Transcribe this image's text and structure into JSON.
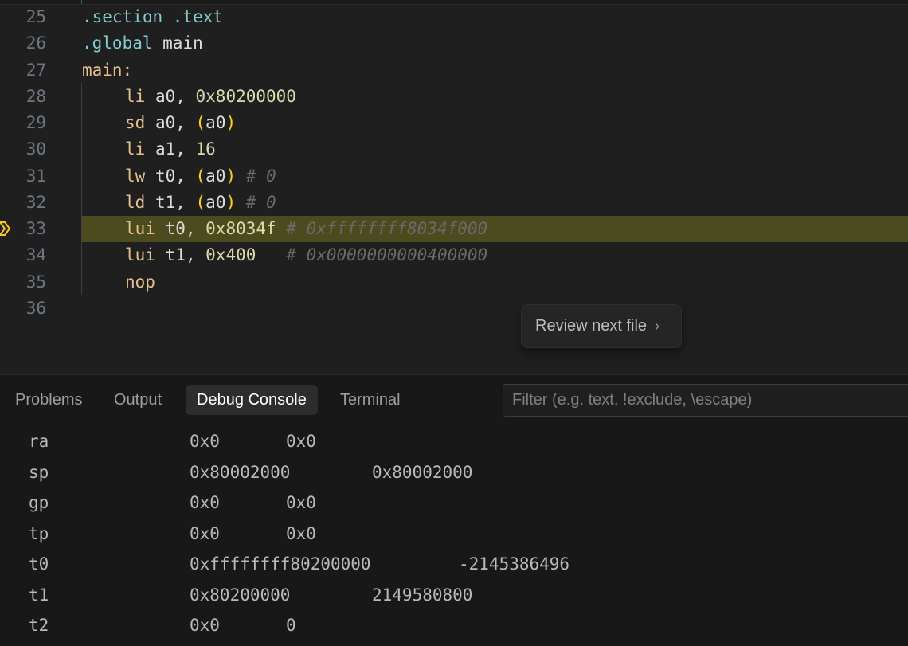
{
  "editor": {
    "lines": [
      {
        "num": "25",
        "parts": [
          {
            "t": ".section .text",
            "c": "c-dir"
          }
        ]
      },
      {
        "num": "26",
        "parts": [
          {
            "t": ".global ",
            "c": "c-dir"
          },
          {
            "t": "main",
            "c": "c-plain"
          }
        ]
      },
      {
        "num": "27",
        "parts": [
          {
            "t": "main:",
            "c": "c-lbl"
          }
        ]
      },
      {
        "num": "28",
        "indent": true,
        "parts": [
          {
            "t": "li ",
            "c": "c-op"
          },
          {
            "t": "a0, ",
            "c": "c-reg"
          },
          {
            "t": "0x80200000",
            "c": "c-num"
          }
        ]
      },
      {
        "num": "29",
        "indent": true,
        "parts": [
          {
            "t": "sd ",
            "c": "c-op"
          },
          {
            "t": "a0, ",
            "c": "c-reg"
          },
          {
            "t": "(",
            "c": "c-paren"
          },
          {
            "t": "a0",
            "c": "c-reg"
          },
          {
            "t": ")",
            "c": "c-paren"
          }
        ]
      },
      {
        "num": "30",
        "indent": true,
        "parts": [
          {
            "t": "li ",
            "c": "c-op"
          },
          {
            "t": "a1, ",
            "c": "c-reg"
          },
          {
            "t": "16",
            "c": "c-num"
          }
        ]
      },
      {
        "num": "31",
        "indent": true,
        "parts": [
          {
            "t": "lw ",
            "c": "c-op"
          },
          {
            "t": "t0, ",
            "c": "c-reg"
          },
          {
            "t": "(",
            "c": "c-paren"
          },
          {
            "t": "a0",
            "c": "c-reg"
          },
          {
            "t": ")",
            "c": "c-paren"
          },
          {
            "t": " # 0",
            "c": "c-com"
          }
        ]
      },
      {
        "num": "32",
        "indent": true,
        "parts": [
          {
            "t": "ld ",
            "c": "c-op"
          },
          {
            "t": "t1, ",
            "c": "c-reg"
          },
          {
            "t": "(",
            "c": "c-paren"
          },
          {
            "t": "a0",
            "c": "c-reg"
          },
          {
            "t": ")",
            "c": "c-paren"
          },
          {
            "t": " # 0",
            "c": "c-com"
          }
        ]
      },
      {
        "num": "33",
        "indent": true,
        "current": true,
        "parts": [
          {
            "t": "lui ",
            "c": "c-op"
          },
          {
            "t": "t0, ",
            "c": "c-reg"
          },
          {
            "t": "0x8034f",
            "c": "c-num"
          },
          {
            "t": " # 0xffffffff8034f000",
            "c": "c-com"
          }
        ]
      },
      {
        "num": "34",
        "indent": true,
        "parts": [
          {
            "t": "lui ",
            "c": "c-op"
          },
          {
            "t": "t1, ",
            "c": "c-reg"
          },
          {
            "t": "0x400",
            "c": "c-num"
          },
          {
            "t": "   # 0x0000000000400000",
            "c": "c-com"
          }
        ]
      },
      {
        "num": "35",
        "indent": true,
        "parts": [
          {
            "t": "nop",
            "c": "c-op"
          }
        ]
      },
      {
        "num": "36",
        "parts": []
      }
    ]
  },
  "review_button": {
    "label": "Review next file",
    "chevron": "chevron-right-icon"
  },
  "panel": {
    "tabs": [
      "Problems",
      "Output",
      "Debug Console",
      "Terminal"
    ],
    "active_tab": "Debug Console",
    "filter_placeholder": "Filter (e.g. text, !exclude, \\escape)",
    "registers": [
      {
        "name": "ra",
        "hex": "0x0",
        "value": "0x0"
      },
      {
        "name": "sp",
        "hex": "0x80002000",
        "value": "0x80002000"
      },
      {
        "name": "gp",
        "hex": "0x0",
        "value": "0x0"
      },
      {
        "name": "tp",
        "hex": "0x0",
        "value": "0x0"
      },
      {
        "name": "t0",
        "hex": "0xffffffff80200000",
        "value": "-2145386496"
      },
      {
        "name": "t1",
        "hex": "0x80200000",
        "value": "2149580800"
      },
      {
        "name": "t2",
        "hex": "0x0",
        "value": "0"
      }
    ]
  },
  "colors": {
    "current_line": "#4b4b1e",
    "breakpoint_arrow": "#ffcc00"
  }
}
